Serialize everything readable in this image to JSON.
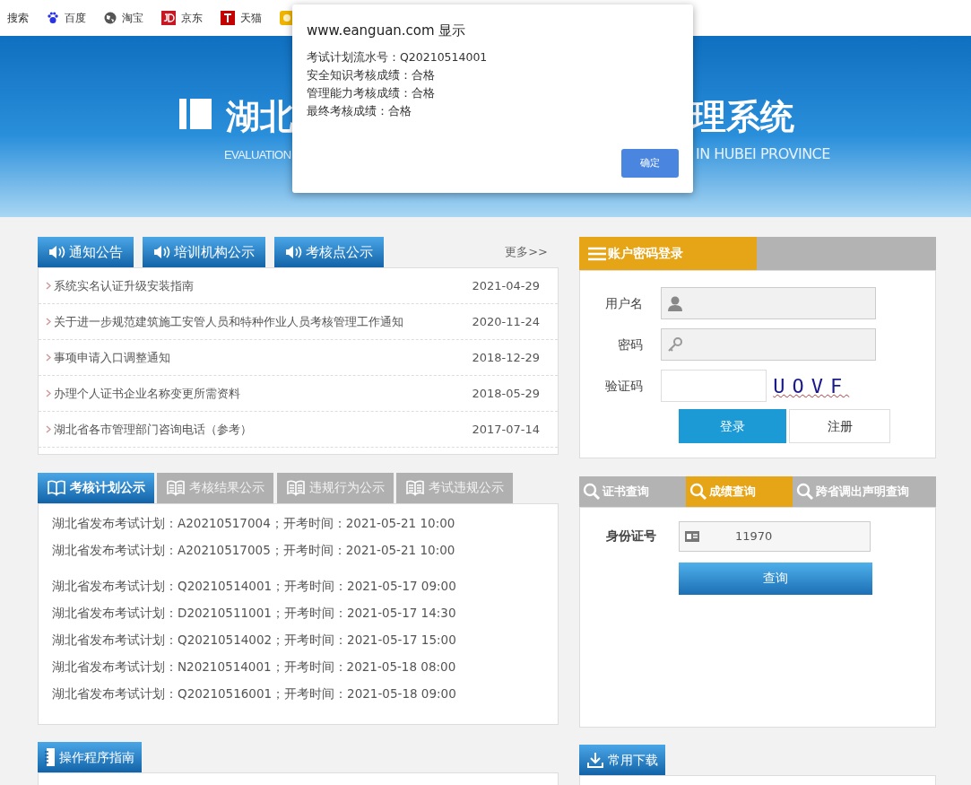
{
  "bookmarks": [
    {
      "label": "搜索",
      "kind": "none"
    },
    {
      "label": "百度",
      "kind": "paw"
    },
    {
      "label": "淘宝",
      "kind": "globe"
    },
    {
      "label": "京东",
      "kind": "jd"
    },
    {
      "label": "天猫",
      "kind": "tmall"
    },
    {
      "kind": "face"
    }
  ],
  "banner": {
    "title_left": "湖北",
    "title_right": "理系统",
    "subtitle_left": "EVALUATION",
    "subtitle_right": "IN HUBEI PROVINCE"
  },
  "dialog": {
    "title": "www.eanguan.com 显示",
    "lines": [
      "考试计划流水号：Q20210514001",
      "安全知识考核成绩：合格",
      "管理能力考核成绩：合格",
      "最终考核成绩：合格"
    ],
    "ok": "确定"
  },
  "notice": {
    "tabs": [
      {
        "label": "通知公告",
        "selected": true
      },
      {
        "label": "培训机构公示",
        "selected": true
      },
      {
        "label": "考核点公示",
        "selected": true
      }
    ],
    "more": "更多>>",
    "items": [
      {
        "title": "系统实名认证升级安装指南",
        "date": "2021-04-29"
      },
      {
        "title": "关于进一步规范建筑施工安管人员和特种作业人员考核管理工作通知",
        "date": "2020-11-24"
      },
      {
        "title": "事项申请入口调整通知",
        "date": "2018-12-29"
      },
      {
        "title": "办理个人证书企业名称变更所需资料",
        "date": "2018-05-29"
      },
      {
        "title": "湖北省各市管理部门咨询电话（参考）",
        "date": "2017-07-14"
      }
    ]
  },
  "login": {
    "tabs": [
      {
        "label": "账户密码登录",
        "selected": true
      }
    ],
    "username_label": "用户名",
    "password_label": "密码",
    "captcha_label": "验证码",
    "captcha": "UOVF",
    "login_button": "登录",
    "register_button": "注册"
  },
  "exam": {
    "tabs": [
      {
        "label": "考核计划公示",
        "selected": true
      },
      {
        "label": "考核结果公示",
        "selected": false
      },
      {
        "label": "违规行为公示",
        "selected": false
      },
      {
        "label": "考试违规公示",
        "selected": false
      }
    ],
    "groups": [
      {
        "items": [
          "湖北省发布考试计划：A20210517004；开考时间：2021-05-21 10:00",
          "湖北省发布考试计划：A20210517005；开考时间：2021-05-21 10:00"
        ]
      },
      {
        "items": [
          "湖北省发布考试计划：Q20210514001；开考时间：2021-05-17 09:00",
          "湖北省发布考试计划：D20210511001；开考时间：2021-05-17 14:30",
          "湖北省发布考试计划：Q20210514002；开考时间：2021-05-17 15:00",
          "湖北省发布考试计划：N20210514001；开考时间：2021-05-18 08:00",
          "湖北省发布考试计划：Q20210516001；开考时间：2021-05-18 09:00"
        ]
      }
    ]
  },
  "query": {
    "tabs": [
      {
        "label": "证书查询",
        "selected": false
      },
      {
        "label": "成绩查询",
        "selected": true
      },
      {
        "label": "跨省调出声明查询",
        "selected": false
      }
    ],
    "id_label": "身份证号",
    "id_value": "11970",
    "button": "查询"
  },
  "guide": {
    "title": "操作程序指南"
  },
  "downloads": {
    "title": "常用下载"
  }
}
